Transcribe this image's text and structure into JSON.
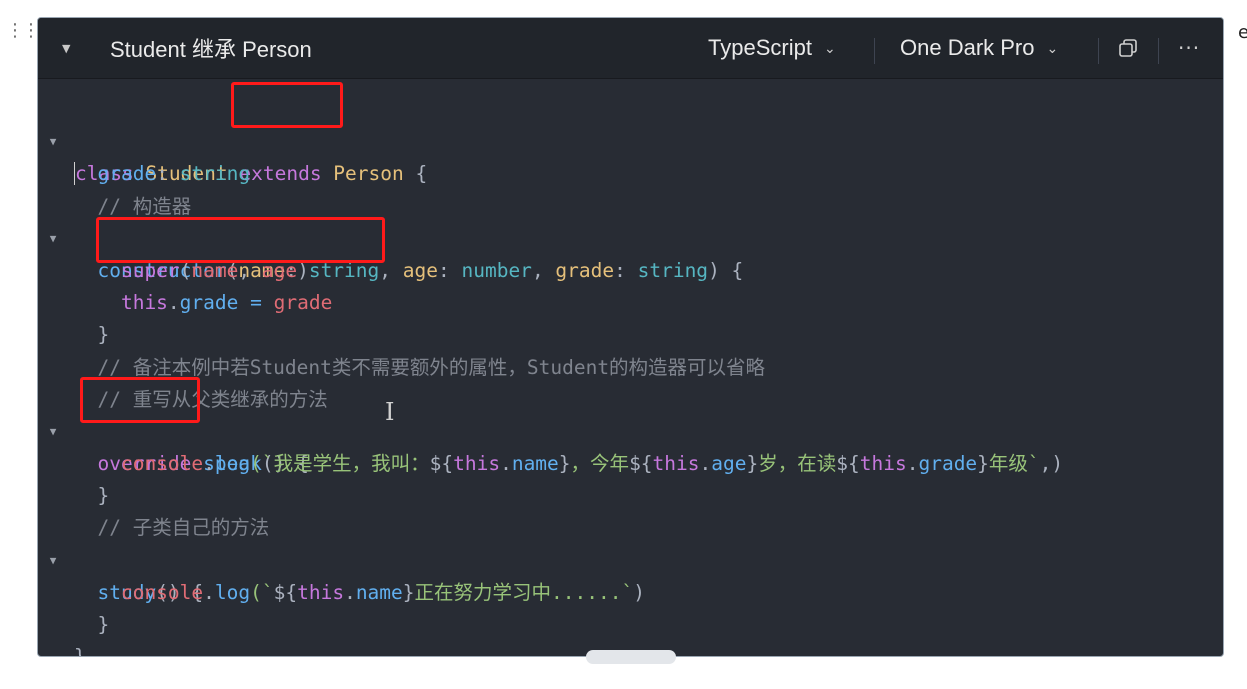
{
  "window": {
    "title": "Student 继承 Person",
    "language": "TypeScript",
    "theme": "One Dark Pro",
    "accent_highlight": "#ff1a1a",
    "icons": [
      "drag-handle-icon",
      "collapse-caret-icon",
      "chevron-down-icon",
      "copy-icon",
      "more-icon"
    ]
  },
  "code": {
    "l1": {
      "a": "class",
      "b": " Student ",
      "c": "extends",
      "d": " Person",
      "e": " {"
    },
    "l2": {
      "a": "  grade",
      "b": ": ",
      "c": "string"
    },
    "l3": {
      "a": "  // 构造器"
    },
    "l4": {
      "a": "  constructor",
      "b": "(",
      "c": "name",
      "d": ": ",
      "e": "string",
      "f": ", ",
      "g": "age",
      "h": ": ",
      "i": "number",
      "j": ", ",
      "k": "grade",
      "l": ": ",
      "m": "string",
      "n": ") {"
    },
    "l5": {
      "a": "    super",
      "b": "(",
      "c": "name",
      "d": ", ",
      "e": "age",
      "f": ")"
    },
    "l6": {
      "a": "    this",
      "b": ".",
      "c": "grade",
      "d": " = ",
      "e": "grade"
    },
    "l7": {
      "a": "  }"
    },
    "l8": {
      "a": "  // 备注本例中若Student类不需要额外的属性，Student的构造器可以省略"
    },
    "l9": {
      "a": "  // 重写从父类继承的方法"
    },
    "l10": {
      "a": "  override",
      "b": " ",
      "c": "speak",
      "d": "() {"
    },
    "l11": {
      "a": "    console",
      "b": ".",
      "c": "log",
      "d": "(`",
      "e": "我是学生，我叫：",
      "f": "${",
      "g": "this",
      "h": ".",
      "i": "name",
      "j": "}",
      "k": "，今年",
      "l": "${",
      "m": "this",
      "n": ".",
      "o": "age",
      "p": "}",
      "q": "岁，在读",
      "r": "${",
      "s": "this",
      "t": ".",
      "u": "grade",
      "v": "}",
      "w": "年级`",
      "x": ",)"
    },
    "l12": {
      "a": "  }"
    },
    "l13": {
      "a": "  // 子类自己的方法"
    },
    "l14": {
      "a": "  study",
      "b": "() {"
    },
    "l15": {
      "a": "    console",
      "b": ".",
      "c": "log",
      "d": "(`",
      "e": "${",
      "f": "this",
      "g": ".",
      "h": "name",
      "i": "}",
      "j": "正在努力学习中......`",
      "k": ")"
    },
    "l16": {
      "a": "  }"
    },
    "l17": {
      "a": "}"
    }
  }
}
